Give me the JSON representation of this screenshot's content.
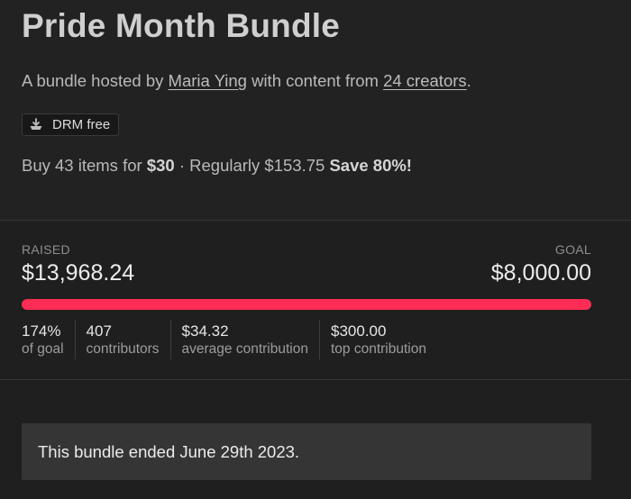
{
  "header": {
    "title": "Pride Month Bundle",
    "subtitle": {
      "prefix": "A bundle hosted by ",
      "host": "Maria Ying",
      "middle": " with content from ",
      "creators": "24 creators",
      "suffix": "."
    },
    "badge": {
      "icon": "download-tray-icon",
      "label": "DRM free"
    },
    "offer": {
      "prefix": "Buy 43 items for ",
      "price": "$30",
      "regular": " · Regularly $153.75 ",
      "save": "Save 80%!"
    }
  },
  "progress": {
    "raised_label": "RAISED",
    "raised_amount": "$13,968.24",
    "goal_label": "GOAL",
    "goal_amount": "$8,000.00",
    "fill_fraction": 1.0,
    "bar_color": "#ff2d55",
    "stats": [
      {
        "value": "174%",
        "label": "of goal"
      },
      {
        "value": "407",
        "label": "contributors"
      },
      {
        "value": "$34.32",
        "label": "average contribution"
      },
      {
        "value": "$300.00",
        "label": "top contribution"
      }
    ]
  },
  "notice": {
    "text": "This bundle ended June 29th 2023."
  }
}
